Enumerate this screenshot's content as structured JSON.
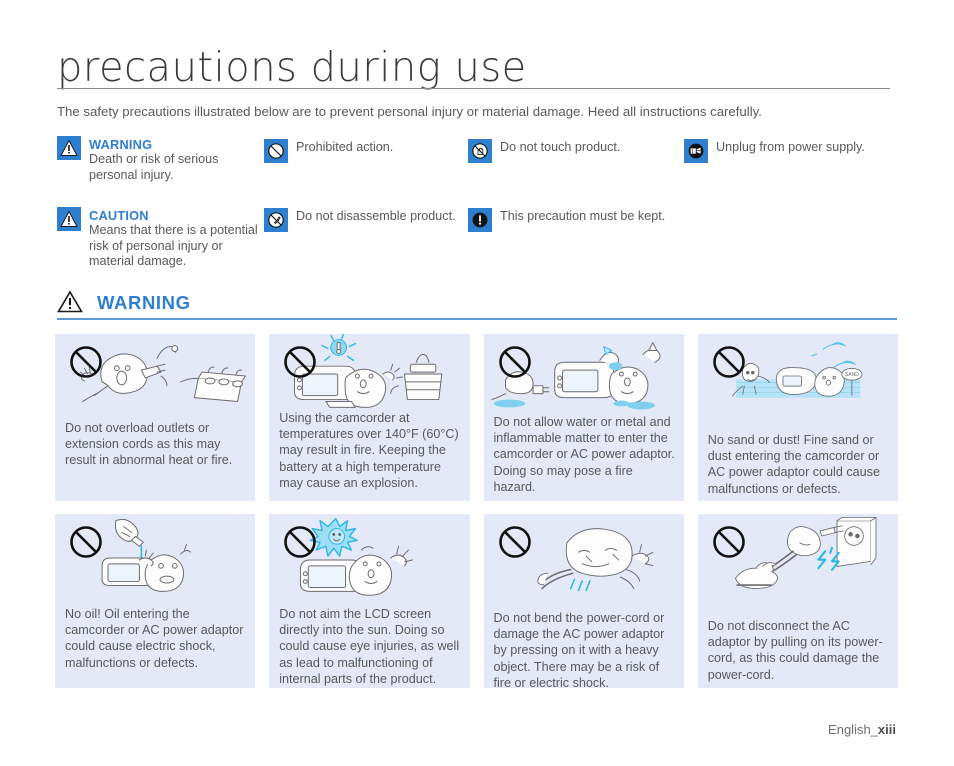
{
  "header": {
    "title": "precautions during use",
    "intro": "The safety precautions illustrated below are to prevent personal injury or material damage. Heed all instructions carefully."
  },
  "legend": {
    "items": [
      {
        "icon": "warning-triangle-icon",
        "heading": "WARNING",
        "text": "Death or risk of serious personal injury."
      },
      {
        "icon": "caution-triangle-icon",
        "heading": "CAUTION",
        "text": "Means that there is a potential risk of personal injury or material damage."
      },
      {
        "icon": "prohibited-action-icon",
        "heading": "",
        "text": "Prohibited action."
      },
      {
        "icon": "do-not-disassemble-icon",
        "heading": "",
        "text": "Do not disassemble product."
      },
      {
        "icon": "do-not-touch-icon",
        "heading": "",
        "text": "Do not touch product."
      },
      {
        "icon": "must-be-kept-icon",
        "heading": "",
        "text": "This precaution must be kept."
      },
      {
        "icon": "unplug-power-icon",
        "heading": "",
        "text": "Unplug from power supply."
      }
    ]
  },
  "section": {
    "label": "WARNING",
    "icon": "warning-triangle-icon"
  },
  "cards": [
    {
      "icon": "prohibited-circle-icon",
      "art": "overloaded-outlet-illustration",
      "text": "Do not overload outlets or extension cords as this may result in abnormal heat or fire."
    },
    {
      "icon": "prohibited-circle-icon",
      "art": "camcorder-high-temperature-illustration",
      "text": "Using the camcorder at temperatures over 140°F (60°C) may result in fire. Keeping the battery at a high temperature may cause an explosion."
    },
    {
      "icon": "prohibited-circle-icon",
      "art": "water-and-metal-illustration",
      "text": "Do not allow water or metal and inflammable matter to enter the camcorder or AC power adaptor. Doing so may pose a fire hazard."
    },
    {
      "icon": "prohibited-circle-icon",
      "art": "sand-and-dust-illustration",
      "text": "No sand or dust! Fine sand or dust entering the camcorder or AC power adaptor could cause malfunctions or defects."
    },
    {
      "icon": "prohibited-circle-icon",
      "art": "oil-bottle-illustration",
      "text": "No oil! Oil entering the camcorder or AC power adaptor could cause electric shock, malfunctions or defects."
    },
    {
      "icon": "prohibited-circle-icon",
      "art": "lcd-aimed-at-sun-illustration",
      "text": "Do not aim the LCD screen directly into the sun. Doing so could cause eye injuries, as well as lead to malfunctioning of internal parts of the product."
    },
    {
      "icon": "prohibited-circle-icon",
      "art": "bent-power-cord-illustration",
      "text": "Do not bend the power-cord or damage the AC power adaptor by pressing on it with a heavy object. There may be a risk of fire or electric shock."
    },
    {
      "icon": "prohibited-circle-icon",
      "art": "pulling-power-cord-illustration",
      "text": "Do not disconnect the AC adaptor by pulling on its power-cord, as this could damage the power-cord."
    }
  ],
  "footer": {
    "prefix": "English_",
    "page": "xiii"
  },
  "colors": {
    "accent_blue": "#2f7fd0",
    "rule_blue": "#5b9bd5",
    "card_bg": "#e3e9f6",
    "text": "#58595b",
    "highlight_cyan": "#29b6e8"
  }
}
